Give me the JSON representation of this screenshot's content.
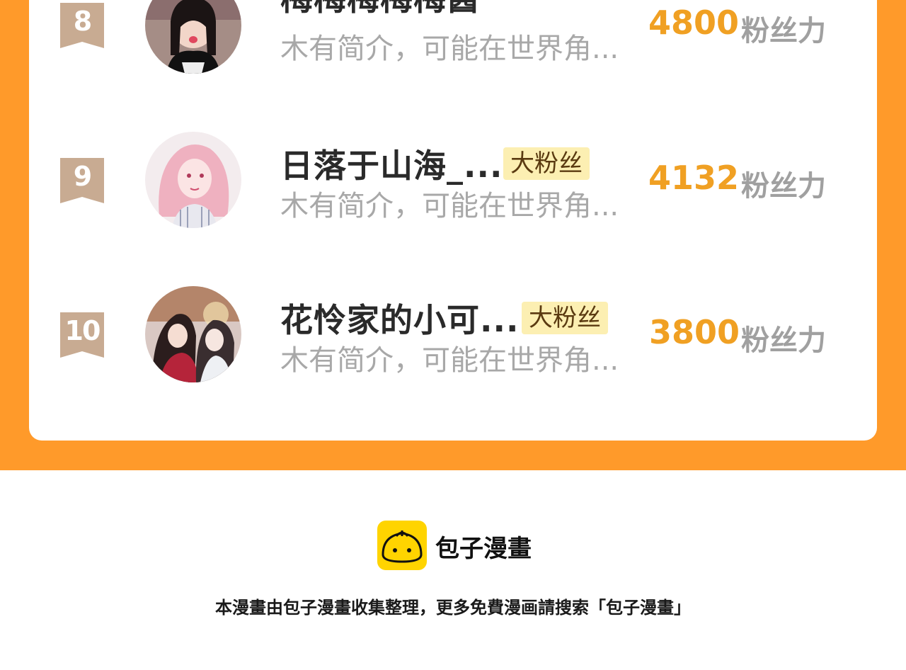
{
  "ranking": {
    "entries": [
      {
        "rank": "8",
        "name": "梅梅梅梅梅酱",
        "badge": "",
        "bio": "木有简介，可能在世界角...",
        "score": "4800",
        "score_unit": "粉丝力",
        "avatar_icon": "avatar-photo-girl-winking"
      },
      {
        "rank": "9",
        "name": "日落于山海_...",
        "badge": "大粉丝",
        "bio": "木有简介，可能在世界角...",
        "score": "4132",
        "score_unit": "粉丝力",
        "avatar_icon": "avatar-illustration-pink-hair"
      },
      {
        "rank": "10",
        "name": "花怜家的小可...",
        "badge": "大粉丝",
        "bio": "木有简介，可能在世界角...",
        "score": "3800",
        "score_unit": "粉丝力",
        "avatar_icon": "avatar-illustration-two-characters"
      }
    ]
  },
  "footer": {
    "brand_name": "包子漫畫",
    "brand_icon": "baozi-bun-icon",
    "note": "本漫畫由包子漫畫收集整理，更多免費漫画請搜索「包子漫畫」"
  },
  "colors": {
    "background_band": "#ff9a2a",
    "score": "#f0a023",
    "badge_bg": "#fcefb2",
    "rank_ribbon": "#c8ab92",
    "brand_yellow": "#ffd400"
  }
}
